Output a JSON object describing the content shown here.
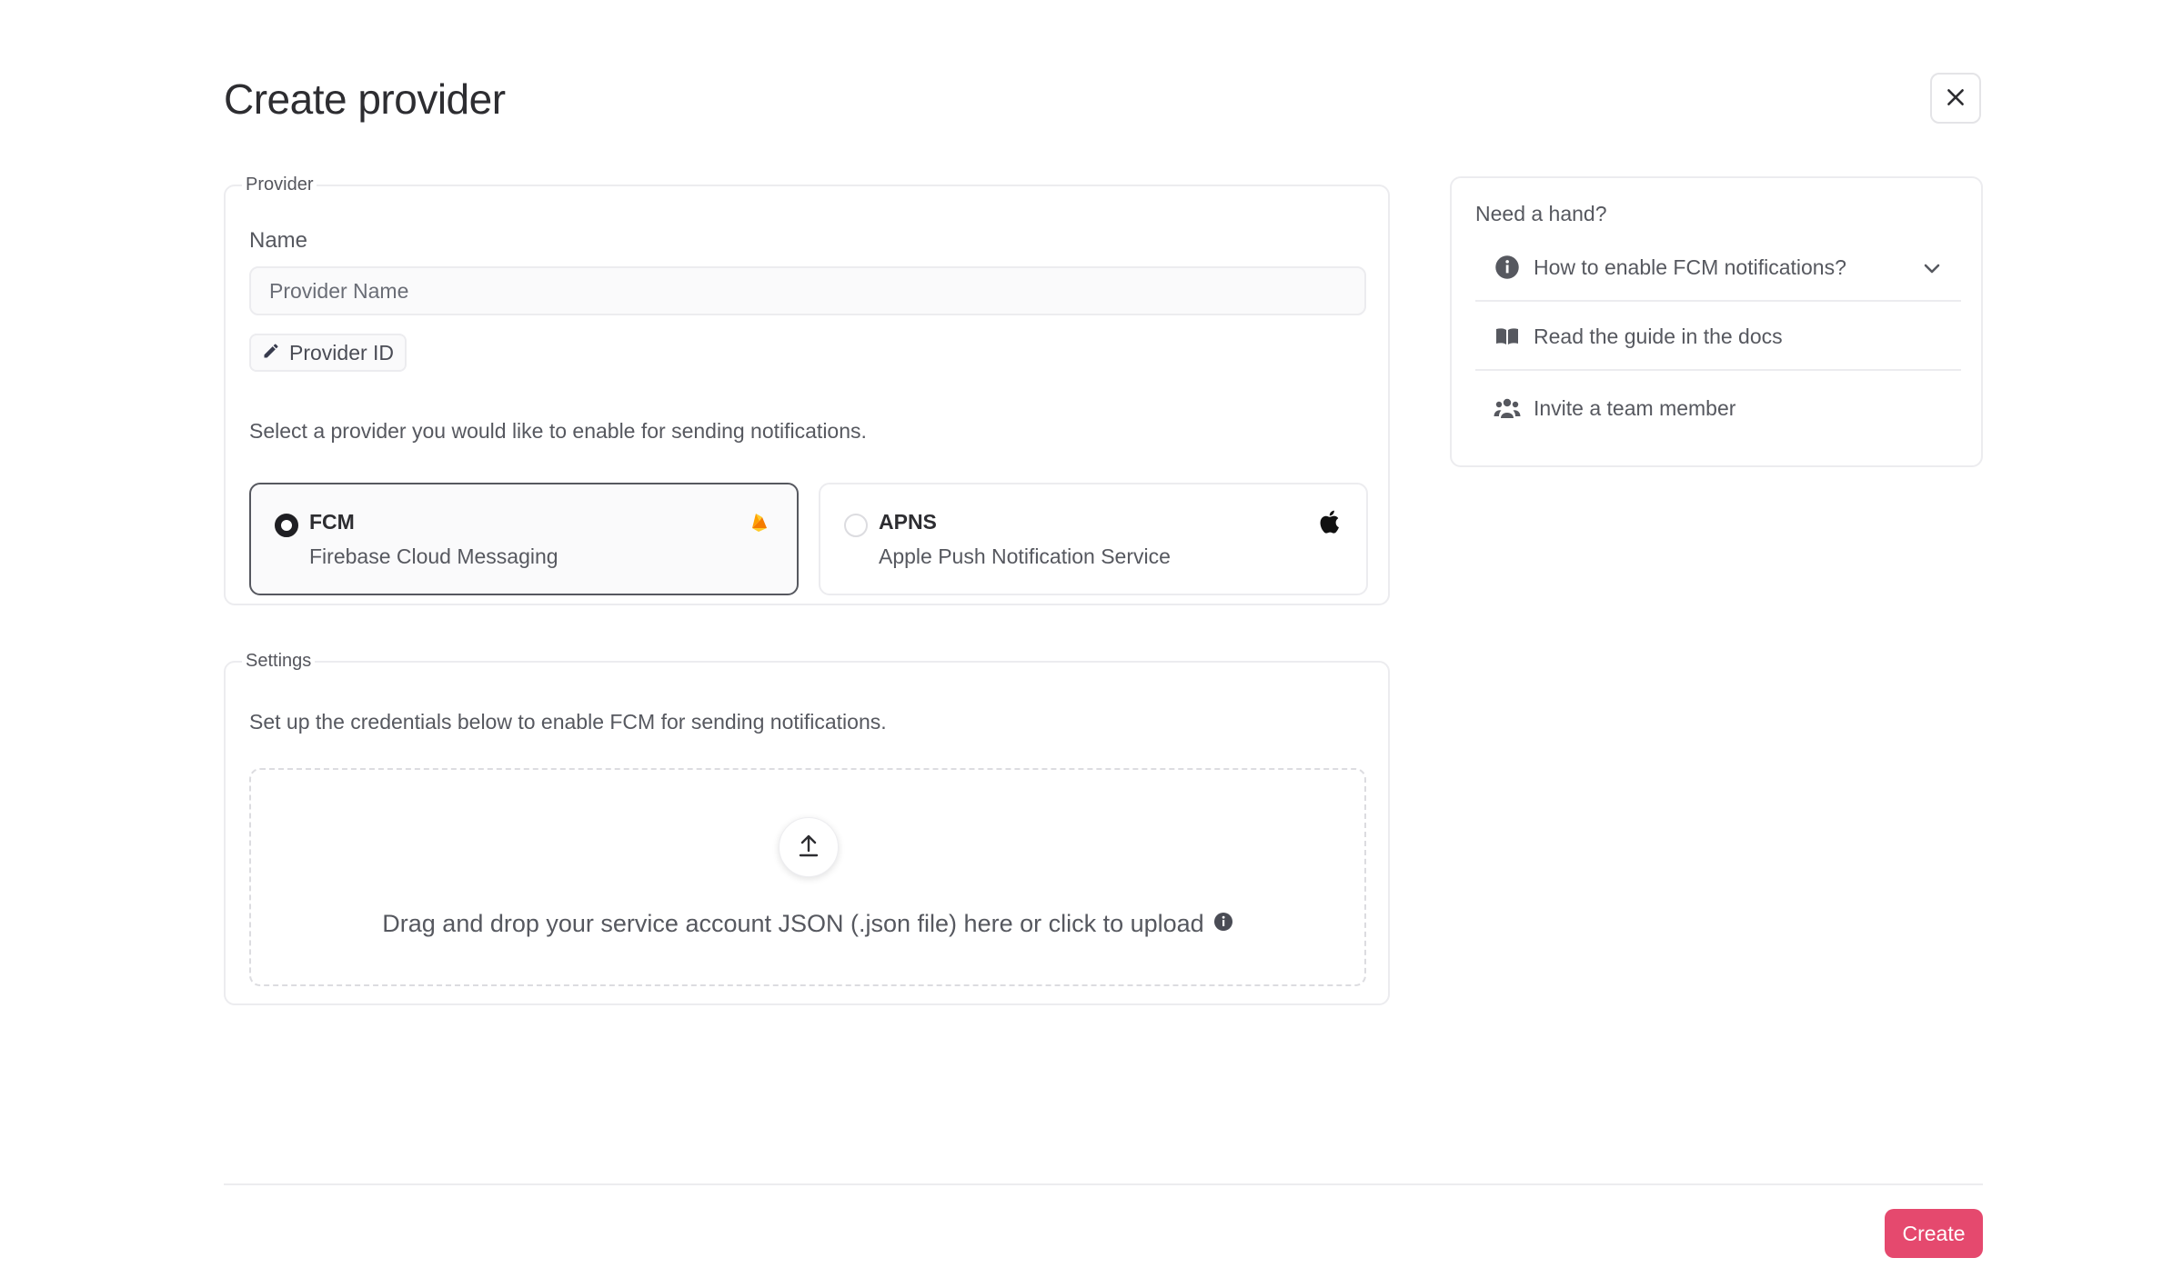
{
  "header": {
    "title": "Create provider"
  },
  "provider_section": {
    "legend": "Provider",
    "name_label": "Name",
    "name_placeholder": "Provider Name",
    "provider_id_label": "Provider ID",
    "select_description": "Select a provider you would like to enable for sending notifications.",
    "options": [
      {
        "title": "FCM",
        "subtitle": "Firebase Cloud Messaging",
        "selected": true,
        "icon": "firebase-icon"
      },
      {
        "title": "APNS",
        "subtitle": "Apple Push Notification Service",
        "selected": false,
        "icon": "apple-icon"
      }
    ]
  },
  "settings_section": {
    "legend": "Settings",
    "description": "Set up the credentials below to enable FCM for sending notifications.",
    "dropzone_text": "Drag and drop your service account JSON (.json file) here or click to upload"
  },
  "help": {
    "title": "Need a hand?",
    "items": [
      {
        "label": "How to enable FCM notifications?",
        "icon": "info-icon"
      },
      {
        "label": "Read the guide in the docs",
        "icon": "book-icon"
      },
      {
        "label": "Invite a team member",
        "icon": "users-icon"
      }
    ]
  },
  "footer": {
    "create_label": "Create"
  },
  "colors": {
    "accent": "#e5496e",
    "border": "#ececef",
    "text": "#56585f"
  }
}
